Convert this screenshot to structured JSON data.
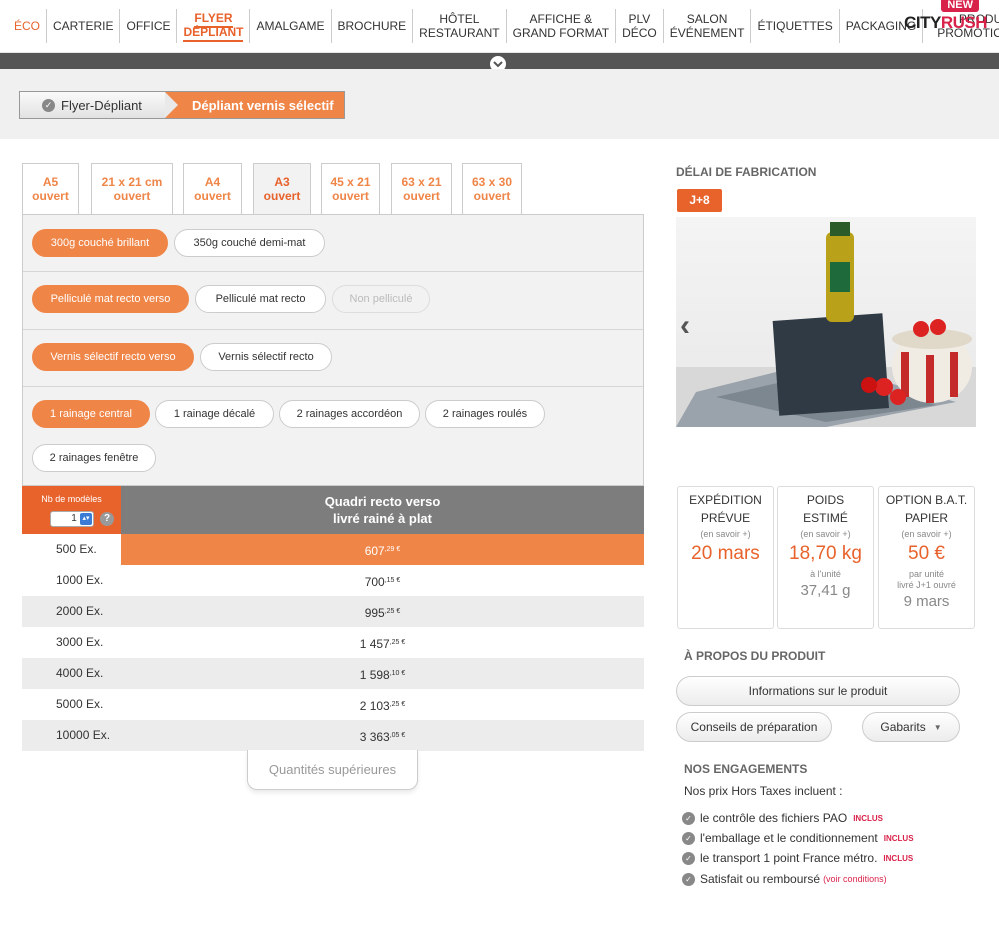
{
  "nav": {
    "items": [
      {
        "label": "ÉCO"
      },
      {
        "label": "CARTERIE"
      },
      {
        "label": "OFFICE"
      },
      {
        "label1": "FLYER",
        "label2": "DÉPLIANT"
      },
      {
        "label": "AMALGAME"
      },
      {
        "label": "BROCHURE"
      },
      {
        "label1": "HÔTEL",
        "label2": "RESTAURANT"
      },
      {
        "label1": "AFFICHE &",
        "label2": "GRAND FORMAT"
      },
      {
        "label1": "PLV",
        "label2": "DÉCO"
      },
      {
        "label1": "SALON",
        "label2": "ÉVÉNEMENT"
      },
      {
        "label": "ÉTIQUETTES"
      },
      {
        "label": "PACKAGING"
      },
      {
        "label1": "PRODUITS",
        "label2": "PROMOTIONNELS"
      }
    ],
    "logo_badge": "NEW",
    "logo_city": "CITY",
    "logo_rush": "RUSH"
  },
  "breadcrumb": {
    "parent": "Flyer-Dépliant",
    "current": "Dépliant vernis sélectif"
  },
  "formats": [
    {
      "line1": "A5",
      "line2": "ouvert"
    },
    {
      "line1": "21 x 21 cm",
      "line2": "ouvert"
    },
    {
      "line1": "A4",
      "line2": "ouvert"
    },
    {
      "line1": "A3",
      "line2": "ouvert"
    },
    {
      "line1": "45 x 21",
      "line2": "ouvert"
    },
    {
      "line1": "63 x 21",
      "line2": "ouvert"
    },
    {
      "line1": "63 x 30",
      "line2": "ouvert"
    }
  ],
  "options": {
    "paper": [
      "300g couché brillant",
      "350g couché demi-mat"
    ],
    "lamination": [
      "Pelliculé mat recto verso",
      "Pelliculé mat recto",
      "Non pelliculé"
    ],
    "varnish": [
      "Vernis sélectif recto verso",
      "Vernis sélectif recto"
    ],
    "creasing": [
      "1 rainage central",
      "1 rainage décalé",
      "2 rainages accordéon",
      "2 rainages roulés",
      "2 rainages fenêtre"
    ]
  },
  "price_table": {
    "models_label": "Nb de modèles",
    "models_value": "1",
    "help": "?",
    "header_line1": "Quadri recto verso",
    "header_line2": "livré rainé à plat",
    "rows": [
      {
        "qty": "500 Ex.",
        "price": "607",
        "cents": ",29 €"
      },
      {
        "qty": "1000 Ex.",
        "price": "700",
        "cents": ",15 €"
      },
      {
        "qty": "2000 Ex.",
        "price": "995",
        "cents": ",25 €"
      },
      {
        "qty": "3000 Ex.",
        "price": "1 457",
        "cents": ",25 €"
      },
      {
        "qty": "4000 Ex.",
        "price": "1 598",
        "cents": ",10 €"
      },
      {
        "qty": "5000 Ex.",
        "price": "2 103",
        "cents": ",25 €"
      },
      {
        "qty": "10000 Ex.",
        "price": "3 363",
        "cents": ",05 €"
      }
    ],
    "more_button": "Quantités supérieures"
  },
  "delay": {
    "title": "DÉLAI DE FABRICATION",
    "badge": "J+8"
  },
  "stats": [
    {
      "title1": "EXPÉDITION",
      "title2": "PRÉVUE",
      "link": "(en savoir +)",
      "value": "20 mars"
    },
    {
      "title1": "POIDS",
      "title2": "ESTIMÉ",
      "link": "(en savoir +)",
      "value": "18,70 kg",
      "sub1": "à l'unité",
      "value2": "37,41 g"
    },
    {
      "title1": "OPTION B.A.T.",
      "title2": "PAPIER",
      "link": "(en savoir +)",
      "value": "50 €",
      "sub1": "par unité",
      "sub2": "livré J+1 ouvré",
      "value2": "9 mars"
    }
  ],
  "about": {
    "title": "À PROPOS DU PRODUIT",
    "info_button": "Informations sur le produit",
    "tips_button": "Conseils de préparation",
    "templates_button": "Gabarits"
  },
  "commitments": {
    "title": "NOS ENGAGEMENTS",
    "intro": "Nos prix Hors Taxes incluent :",
    "items": [
      {
        "text": "le contrôle des fichiers PAO",
        "tag": "INCLUS"
      },
      {
        "text": "l'emballage et le conditionnement",
        "tag": "INCLUS"
      },
      {
        "text": "le transport 1 point France métro.",
        "tag": "INCLUS"
      },
      {
        "text": "Satisfait ou remboursé",
        "tag": "(voir conditions)"
      }
    ]
  },
  "colors": {
    "accent": "#ef8547",
    "brand_red": "#d9224a",
    "dark_bar": "#555555"
  }
}
